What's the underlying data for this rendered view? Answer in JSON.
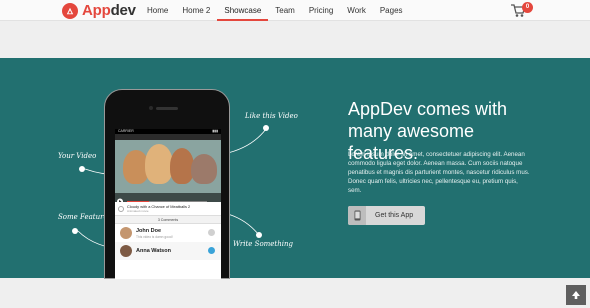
{
  "brand": {
    "name_accent": "App",
    "name_rest": "dev",
    "accent_color": "#e4473d"
  },
  "nav": {
    "items": [
      {
        "label": "Home",
        "active": false
      },
      {
        "label": "Home 2",
        "active": false
      },
      {
        "label": "Showcase",
        "active": true
      },
      {
        "label": "Team",
        "active": false
      },
      {
        "label": "Pricing",
        "active": false
      },
      {
        "label": "Work",
        "active": false
      },
      {
        "label": "Pages",
        "active": false
      }
    ],
    "cart_count": "0"
  },
  "hero": {
    "background": "#227070",
    "title": "AppDev comes with many awesome features.",
    "description": "Lorem ipsum dolor sit amet, consectetuer adipiscing elit. Aenean commodo ligula eget dolor. Aenean massa. Cum sociis natoque penatibus et magnis dis parturient montes, nascetur ridiculus mus. Donec quam felis, ultricies nec, pellentesque eu, pretium quis, sem.",
    "cta_label": "Get this App"
  },
  "annotations": {
    "your_video": "Your Video",
    "like_video": "Like this Video",
    "some_feature": "Some Feature",
    "write_something": "Write Something"
  },
  "phone": {
    "carrier": "CARRIER",
    "video_title": "Cloudy with a Chance of Meatballs 2",
    "video_subtitle": "Animated movie",
    "comments_count": "3 Comments",
    "comments": [
      {
        "name": "John Doe",
        "text": "This video is damn good!"
      },
      {
        "name": "Anna Watson",
        "text": ""
      }
    ]
  }
}
